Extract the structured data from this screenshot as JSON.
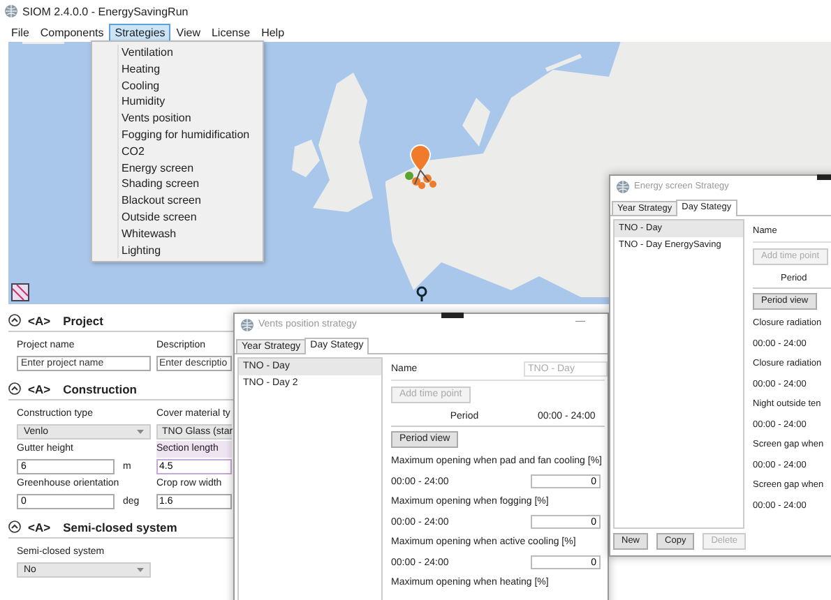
{
  "window": {
    "title": "SIOM 2.4.0.0 - EnergySavingRun"
  },
  "menu": [
    {
      "label": "File",
      "selected": false
    },
    {
      "label": "Components",
      "selected": false
    },
    {
      "label": "Strategies",
      "selected": true
    },
    {
      "label": "View",
      "selected": false
    },
    {
      "label": "License",
      "selected": false
    },
    {
      "label": "Help",
      "selected": false
    }
  ],
  "strategies_menu": {
    "items": [
      "Ventilation",
      "Heating",
      "Cooling",
      "Humidity",
      "Vents position",
      "Fogging for humidification",
      "CO2",
      "Energy screen",
      "Shading screen",
      "Blackout screen",
      "Outside screen",
      "Whitewash",
      "Lighting"
    ]
  },
  "sections": [
    {
      "prefix": "<A>",
      "title": "Project",
      "expanded": true,
      "rows": [
        [
          {
            "kind": "text",
            "label": "Project name",
            "placeholder": "Enter project name"
          },
          {
            "kind": "text",
            "label": "Description",
            "placeholder": "Enter descriptio"
          }
        ]
      ]
    },
    {
      "prefix": "<A>",
      "title": "Construction",
      "expanded": true,
      "rows": [
        [
          {
            "kind": "dropdown",
            "label": "Construction type",
            "value": "Venlo"
          },
          {
            "kind": "dropdown",
            "label": "Cover material ty",
            "value": "TNO Glass (star"
          }
        ],
        [
          {
            "kind": "text",
            "label": "Gutter height",
            "value": "6",
            "unit": "m"
          },
          {
            "kind": "text",
            "label": "Section length",
            "value": "4.5",
            "focused": true
          }
        ],
        [
          {
            "kind": "text",
            "label": "Greenhouse orientation",
            "value": "0",
            "unit": "deg"
          },
          {
            "kind": "text",
            "label": "Crop row width",
            "value": "1.6"
          }
        ]
      ]
    },
    {
      "prefix": "<A>",
      "title": "Semi-closed system",
      "expanded": true,
      "rows": [
        [
          {
            "kind": "dropdown",
            "label": "Semi-closed system",
            "value": "No"
          }
        ]
      ]
    }
  ],
  "vents_dialog": {
    "title": "Vents position strategy",
    "minimize": "—",
    "tabs": [
      {
        "label": "Year Strategy",
        "selected": false
      },
      {
        "label": "Day Stategy",
        "selected": true
      }
    ],
    "list": [
      {
        "label": "TNO - Day",
        "selected": true
      },
      {
        "label": "TNO - Day 2",
        "selected": false
      }
    ],
    "name_label": "Name",
    "name_value": "TNO - Day",
    "add_button": {
      "label": "Add time point",
      "disabled": true
    },
    "period_label": "Period",
    "period_value": "00:00 - 24:00",
    "period_view_button": "Period view",
    "params": [
      {
        "label": "Maximum opening when pad and fan cooling [%]",
        "time": "00:00 - 24:00",
        "value": "0"
      },
      {
        "label": "Maximum opening when fogging [%]",
        "time": "00:00 - 24:00",
        "value": "0"
      },
      {
        "label": "Maximum opening when active cooling [%]",
        "time": "00:00 - 24:00",
        "value": "0"
      },
      {
        "label": "Maximum opening when heating [%]"
      }
    ]
  },
  "energy_dialog": {
    "title": "Energy screen Strategy",
    "tabs": [
      {
        "label": "Year Strategy",
        "selected": false
      },
      {
        "label": "Day Stategy",
        "selected": true
      }
    ],
    "list": [
      {
        "label": "TNO - Day",
        "selected": true
      },
      {
        "label": "TNO - Day EnergySaving",
        "selected": false
      }
    ],
    "name_label": "Name",
    "add_button": {
      "label": "Add time point",
      "disabled": true
    },
    "period_label": "Period",
    "period_view_button": "Period view",
    "params": [
      {
        "label": "Closure radiation",
        "time": "00:00 - 24:00"
      },
      {
        "label": "Closure radiation",
        "time": "00:00 - 24:00"
      },
      {
        "label": "Night outside ten",
        "time": "00:00 - 24:00"
      },
      {
        "label": "Screen gap when",
        "time": "00:00 - 24:00"
      },
      {
        "label": "Screen gap when",
        "time": "00:00 - 24:00"
      }
    ],
    "buttons": [
      {
        "label": "New",
        "disabled": false
      },
      {
        "label": "Copy",
        "disabled": false
      },
      {
        "label": "Delete",
        "disabled": true
      }
    ]
  }
}
